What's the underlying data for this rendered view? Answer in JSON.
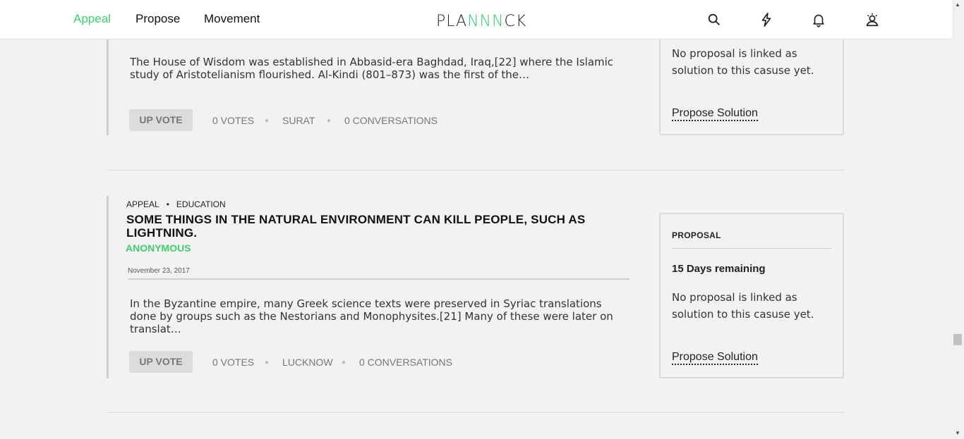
{
  "nav": {
    "links": [
      "Appeal",
      "Propose",
      "Movement"
    ],
    "logo_pre": "PLA",
    "logo_mid": "NNN",
    "logo_post": "CK",
    "icons": [
      "search-icon",
      "lightning-icon",
      "bell-icon",
      "user-icon"
    ],
    "accent_color": "#3ecf6e"
  },
  "posts": [
    {
      "excerpt": "The House of Wisdom was established in Abbasid-era Baghdad, Iraq,[22] where the Islamic study of Aristotelianism flourished. Al-Kindi (801–873) was the first of the…",
      "upvote": "UP VOTE",
      "votes": "0 VOTES",
      "location": "SURAT",
      "conversations": "0 CONVERSATIONS",
      "side": {
        "text": "No proposal is linked as solution to this casuse yet.",
        "link": "Propose Solution"
      }
    },
    {
      "category": "APPEAL",
      "subcategory": "EDUCATION",
      "title": "SOME THINGS IN THE NATURAL ENVIRONMENT CAN KILL PEOPLE, SUCH AS LIGHTNING.",
      "author": "ANONYMOUS",
      "date": "November 23, 2017",
      "excerpt": "In the Byzantine empire, many Greek science texts were preserved in Syriac translations done by groups such as the Nestorians and Monophysites.[21] Many of these were later on translat…",
      "upvote": "UP VOTE",
      "votes": "0 VOTES",
      "location": "LUCKNOW",
      "conversations": "0 CONVERSATIONS",
      "side": {
        "label": "PROPOSAL",
        "days": "15 Days remaining",
        "text": "No proposal is linked as solution to this casuse yet.",
        "link": "Propose Solution"
      }
    }
  ]
}
